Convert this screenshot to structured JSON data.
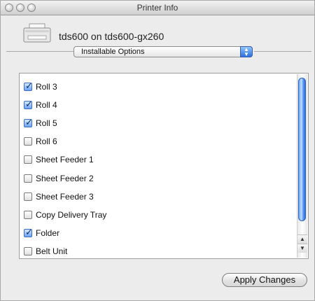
{
  "window": {
    "title": "Printer Info"
  },
  "printer": {
    "icon": "printer-icon",
    "name": "tds600 on tds600-gx260"
  },
  "options_popup": {
    "selected": "Installable Options"
  },
  "options_list": {
    "items": [
      {
        "label": "Roll 3",
        "checked": true
      },
      {
        "label": "Roll 4",
        "checked": true
      },
      {
        "label": "Roll 5",
        "checked": true
      },
      {
        "label": "Roll 6",
        "checked": false
      },
      {
        "label": "Sheet Feeder 1",
        "checked": false
      },
      {
        "label": "Sheet Feeder 2",
        "checked": false
      },
      {
        "label": "Sheet Feeder 3",
        "checked": false
      },
      {
        "label": "Copy Delivery Tray",
        "checked": false
      },
      {
        "label": "Folder",
        "checked": true
      },
      {
        "label": "Belt Unit",
        "checked": false
      }
    ]
  },
  "buttons": {
    "apply_label": "Apply Changes"
  },
  "colors": {
    "accent": "#2f6fe0",
    "window_bg": "#ececec"
  }
}
